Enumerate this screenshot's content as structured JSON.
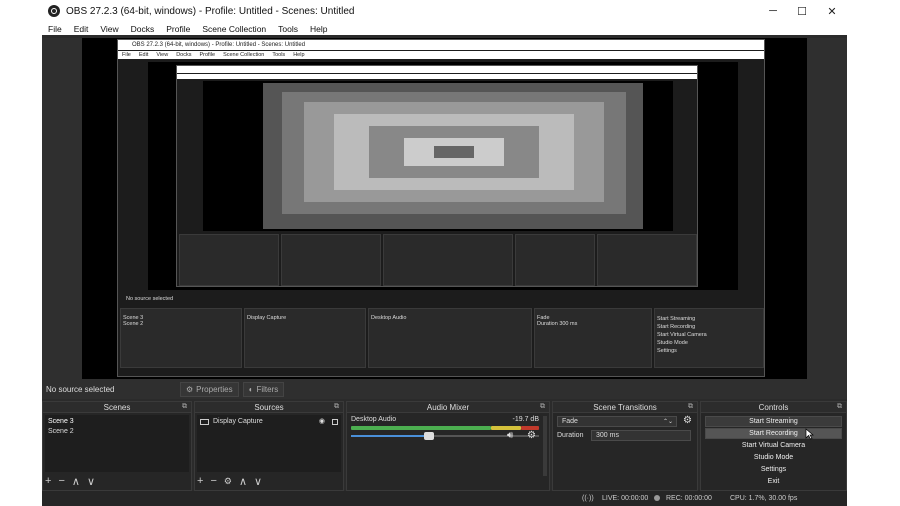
{
  "window": {
    "title": "OBS 27.2.3 (64-bit, windows) - Profile: Untitled - Scenes: Untitled",
    "minimize": "─",
    "maximize": "☐",
    "close": "✕"
  },
  "menu": [
    "File",
    "Edit",
    "View",
    "Docks",
    "Profile",
    "Scene Collection",
    "Tools",
    "Help"
  ],
  "source_bar": {
    "status": "No source selected",
    "properties": "Properties",
    "filters": "Filters"
  },
  "scenes": {
    "title": "Scenes",
    "items": [
      "Scene 3",
      "Scene 2"
    ]
  },
  "sources": {
    "title": "Sources",
    "items": [
      "Display Capture"
    ]
  },
  "audio_mixer": {
    "title": "Audio Mixer",
    "channel": "Desktop Audio",
    "level": "-19.7 dB",
    "volume_fraction": 0.52
  },
  "transitions": {
    "title": "Scene Transitions",
    "transition": "Fade",
    "duration_label": "Duration",
    "duration_value": "300 ms"
  },
  "controls": {
    "title": "Controls",
    "buttons": [
      "Start Streaming",
      "Start Recording",
      "Start Virtual Camera",
      "Studio Mode",
      "Settings",
      "Exit"
    ]
  },
  "status": {
    "live": "LIVE: 00:00:00",
    "rec": "REC: 00:00:00",
    "cpu": "CPU: 1.7%, 30.00 fps"
  },
  "toolbar_glyphs": {
    "add": "+",
    "remove": "−",
    "up": "∧",
    "down": "∨",
    "gear": "⚙"
  },
  "colors": {
    "background": "#2b2b2b",
    "panel": "#262626",
    "meter_green": "#4caf50",
    "meter_yellow": "#d4c13b",
    "meter_red": "#c0392b",
    "slider": "#4a90d9"
  }
}
